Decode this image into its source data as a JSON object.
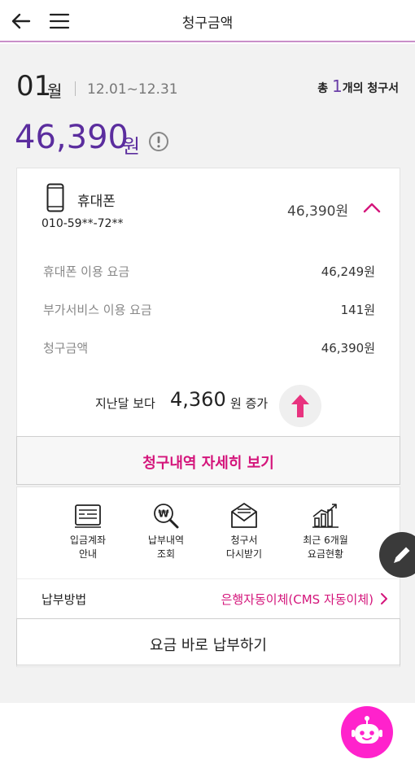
{
  "header": {
    "title": "청구금액"
  },
  "bill": {
    "month": "01",
    "month_unit": "월",
    "period": "12.01~12.31",
    "count_prefix": "총",
    "count": "1",
    "count_suffix": "개의 청구서",
    "total": "46,390",
    "total_unit": "원"
  },
  "device": {
    "name": "휴대폰",
    "number": "010-59**-72**",
    "amount": "46,390원"
  },
  "line_items": [
    {
      "label": "휴대폰 이용 요금",
      "value": "46,249원"
    },
    {
      "label": "부가서비스 이용 요금",
      "value": "141원"
    },
    {
      "label": "청구금액",
      "value": "46,390원"
    }
  ],
  "comparison": {
    "prefix": "지난달 보다",
    "amount": "4,360",
    "suffix": "원 증가"
  },
  "buttons": {
    "detail": "청구내역 자세히 보기",
    "pay_now": "요금 바로 납부하기"
  },
  "quick_menu": [
    {
      "line1": "입금계좌",
      "line2": "안내",
      "icon": "account-card-icon"
    },
    {
      "line1": "납부내역",
      "line2": "조회",
      "icon": "won-search-icon"
    },
    {
      "line1": "청구서",
      "line2": "다시받기",
      "icon": "mail-icon"
    },
    {
      "line1": "최근 6개월",
      "line2": "요금현황",
      "icon": "bar-chart-icon"
    }
  ],
  "payment": {
    "label": "납부방법",
    "method": "은행자동이체(CMS 자동이체)"
  },
  "colors": {
    "accent_purple": "#5b2d9e",
    "accent_pink": "#d4157b",
    "chatbot": "#ff22cc"
  }
}
